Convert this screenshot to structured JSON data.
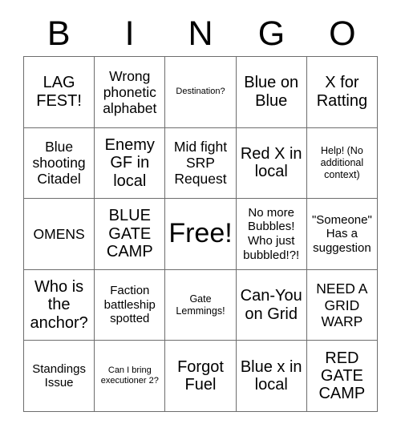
{
  "card": {
    "type": "bingo-card",
    "columns": 5,
    "rows": 5,
    "header_letters": [
      "B",
      "I",
      "N",
      "G",
      "O"
    ],
    "free_space_label": "Free!",
    "free_space_index": {
      "row": 2,
      "col": 2
    },
    "colors": {
      "background": "#ffffff",
      "text": "#000000",
      "border": "#6d6d6d"
    },
    "cells": [
      [
        {
          "text": "LAG FEST!",
          "size": "fs-xl"
        },
        {
          "text": "Wrong phonetic alphabet",
          "size": "fs-l"
        },
        {
          "text": "Destination?",
          "size": "fs-xs"
        },
        {
          "text": "Blue on Blue",
          "size": "fs-xl"
        },
        {
          "text": "X for Ratting",
          "size": "fs-xl"
        }
      ],
      [
        {
          "text": "Blue shooting Citadel",
          "size": "fs-l"
        },
        {
          "text": "Enemy GF in local",
          "size": "fs-xl"
        },
        {
          "text": "Mid fight SRP Request",
          "size": "fs-l"
        },
        {
          "text": "Red X in local",
          "size": "fs-xl"
        },
        {
          "text": "Help! (No additional context)",
          "size": "fs-s"
        }
      ],
      [
        {
          "text": "OMENS",
          "size": "fs-l"
        },
        {
          "text": "BLUE GATE CAMP",
          "size": "fs-xl"
        },
        {
          "text": "Free!",
          "size": "fs-xxl"
        },
        {
          "text": "No more Bubbles! Who just bubbled!?!",
          "size": "fs-m"
        },
        {
          "text": "\"Someone\" Has a suggestion",
          "size": "fs-m"
        }
      ],
      [
        {
          "text": "Who is the anchor?",
          "size": "fs-xl"
        },
        {
          "text": "Faction battleship spotted",
          "size": "fs-m"
        },
        {
          "text": "Gate Lemmings!",
          "size": "fs-s"
        },
        {
          "text": "Can-You on Grid",
          "size": "fs-xl"
        },
        {
          "text": "NEED A GRID WARP",
          "size": "fs-l"
        }
      ],
      [
        {
          "text": "Standings Issue",
          "size": "fs-m"
        },
        {
          "text": "Can I bring executioner 2?",
          "size": "fs-xs"
        },
        {
          "text": "Forgot Fuel",
          "size": "fs-xl"
        },
        {
          "text": "Blue x in local",
          "size": "fs-xl"
        },
        {
          "text": "RED GATE CAMP",
          "size": "fs-xl"
        }
      ]
    ]
  }
}
